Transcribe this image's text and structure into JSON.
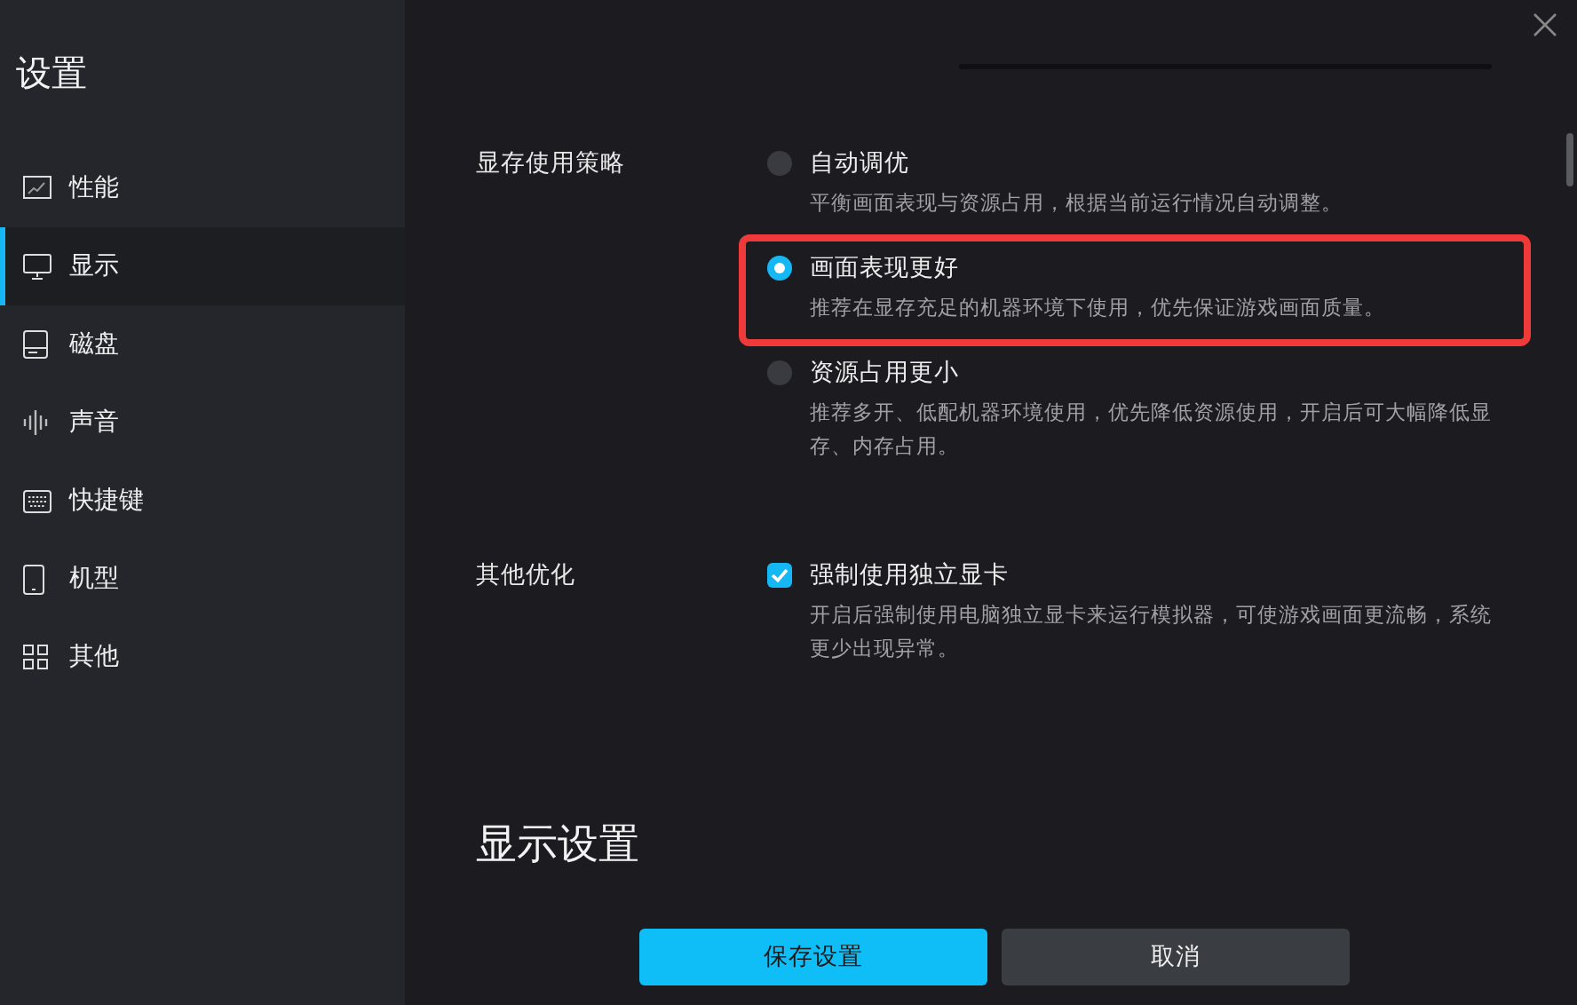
{
  "sidebar": {
    "title": "设置",
    "items": [
      {
        "label": "性能",
        "selected": false
      },
      {
        "label": "显示",
        "selected": true
      },
      {
        "label": "磁盘",
        "selected": false
      },
      {
        "label": "声音",
        "selected": false
      },
      {
        "label": "快捷键",
        "selected": false
      },
      {
        "label": "机型",
        "selected": false
      },
      {
        "label": "其他",
        "selected": false
      }
    ]
  },
  "sections": [
    {
      "label": "显存使用策略",
      "kind": "radio",
      "options": [
        {
          "title": "自动调优",
          "description": "平衡画面表现与资源占用，根据当前运行情况自动调整。",
          "selected": false,
          "highlighted": false
        },
        {
          "title": "画面表现更好",
          "description": "推荐在显存充足的机器环境下使用，优先保证游戏画面质量。",
          "selected": true,
          "highlighted": true
        },
        {
          "title": "资源占用更小",
          "description": "推荐多开、低配机器环境使用，优先降低资源使用，开启后可大幅降低显存、内存占用。",
          "selected": false,
          "highlighted": false
        }
      ]
    },
    {
      "label": "其他优化",
      "kind": "checkbox",
      "options": [
        {
          "title": "强制使用独立显卡",
          "description": "开启后强制使用电脑独立显卡来运行模拟器，可使游戏画面更流畅，系统更少出现异常。",
          "checked": true
        }
      ]
    }
  ],
  "heading": "显示设置",
  "buttons": [
    {
      "label": "保存设置",
      "kind": "primary"
    },
    {
      "label": "取消",
      "kind": "secondary"
    }
  ]
}
